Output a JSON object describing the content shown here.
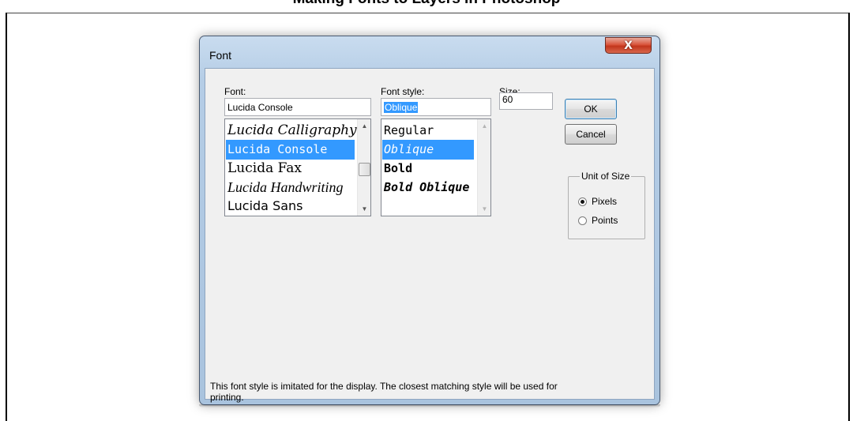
{
  "backdrop": {
    "top_text": "Making Fonts to Layers in Photoshop"
  },
  "dialog": {
    "title": "Font",
    "close_glyph": "X",
    "font": {
      "label": "Font:",
      "value": "Lucida Console",
      "items": [
        {
          "label": "Lucida Calligraphy",
          "style": "calligraphy"
        },
        {
          "label": "Lucida Console",
          "style": "console",
          "selected": true
        },
        {
          "label": "Lucida Fax",
          "style": "fax"
        },
        {
          "label": "Lucida Handwriting",
          "style": "handwriting"
        },
        {
          "label": "Lucida Sans",
          "style": "sans"
        }
      ]
    },
    "style": {
      "label": "Font style:",
      "value": "Oblique",
      "items": [
        {
          "label": "Regular"
        },
        {
          "label": "Oblique",
          "selected": true
        },
        {
          "label": "Bold"
        },
        {
          "label": "Bold Oblique"
        }
      ]
    },
    "size": {
      "label": "Size:",
      "value": "60"
    },
    "buttons": {
      "ok": "OK",
      "cancel": "Cancel"
    },
    "unit_of_size": {
      "legend": "Unit of Size",
      "options": [
        {
          "label": "Pixels",
          "checked": true
        },
        {
          "label": "Points",
          "checked": false
        }
      ]
    },
    "note": "This font style is imitated for the display. The closest matching style will be used for printing."
  }
}
